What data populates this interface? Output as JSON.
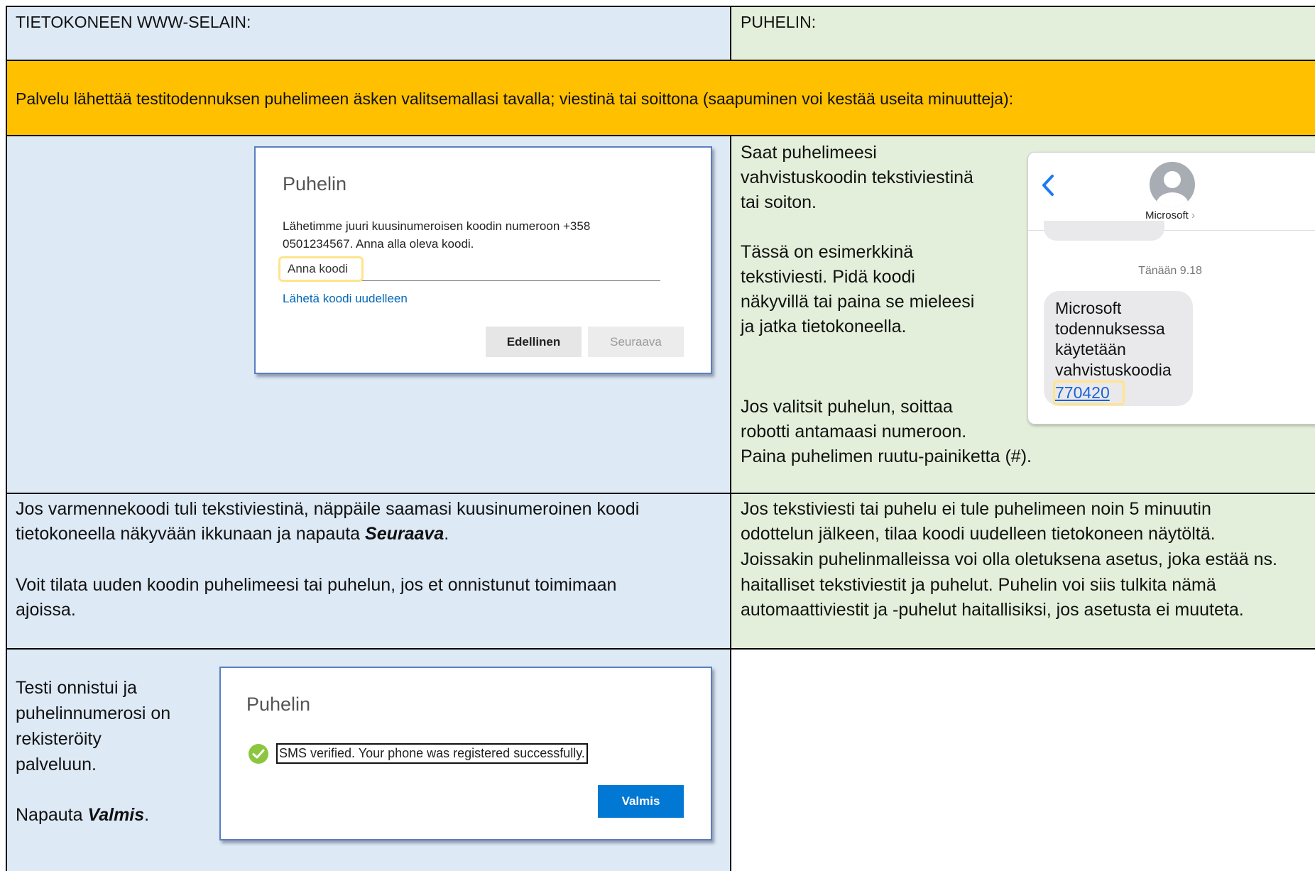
{
  "header": {
    "left": "TIETOKONEEN WWW-SELAIN:",
    "right": "PUHELIN:"
  },
  "banner": "Palvelu lähettää testitodennuksen puhelimeen äsken valitsemallasi tavalla; viestinä tai soittona (saapuminen voi kestää useita minuutteja):",
  "code_dialog": {
    "title": "Puhelin",
    "message_line1": "Lähetimme juuri kuusinumeroisen koodin numeroon +358",
    "message_line2": "0501234567. Anna alla oleva koodi.",
    "input_placeholder": "Anna koodi",
    "resend_link": "Lähetä koodi uudelleen",
    "back_button": "Edellinen",
    "next_button": "Seuraava"
  },
  "phone_instructions": {
    "lines_a": [
      "Saat puhelimeesi",
      "vahvistuskoodin tekstiviestinä",
      "tai soiton."
    ],
    "lines_b": [
      "Tässä on esimerkkinä",
      "tekstiviesti. Pidä koodi",
      "näkyvillä tai paina se mieleesi",
      "ja jatka tietokoneella."
    ],
    "lines_c": [
      "Jos valitsit puhelun, soittaa",
      "robotti antamaasi numeroon.",
      "Paina puhelimen ruutu-painiketta (#)."
    ]
  },
  "sms": {
    "sender": "Microsoft",
    "timestamp": "Tänään 9.18",
    "message_lines": [
      "Microsoft",
      "todennuksessa",
      "käytetään",
      "vahvistuskoodia"
    ],
    "code": "770420",
    "back_icon": "chevron-left-icon",
    "avatar_icon": "person-avatar-icon"
  },
  "left_instructions": {
    "p1_line1": "Jos varmennekoodi tuli tekstiviestinä, näppäile saamasi kuusinumeroinen koodi",
    "p1_line2_pre": "tietokoneella näkyvään ikkunaan ja napauta ",
    "p1_line2_bold": "Seuraava",
    "p1_line2_post": ".",
    "p2_line1": "Voit tilata uuden koodin puhelimeesi tai puhelun, jos et onnistunut toimimaan",
    "p2_line2": "ajoissa."
  },
  "right_instructions": {
    "lines": [
      "Jos tekstiviesti tai puhelu ei tule puhelimeen noin 5 minuutin",
      "odottelun jälkeen, tilaa koodi uudelleen tietokoneen näytöltä.",
      "Joissakin puhelinmalleissa voi olla oletuksena asetus, joka estää ns.",
      "haitalliset tekstiviestit ja puhelut. Puhelin voi siis tulkita nämä",
      "automaattiviestit ja -puhelut haitallisiksi, jos asetusta ei muuteta."
    ]
  },
  "success": {
    "lines": [
      "Testi onnistui ja",
      "puhelinnumerosi on",
      "rekisteröity",
      "palveluun."
    ],
    "tap_pre": "Napauta ",
    "tap_bold": "Valmis",
    "tap_post": ".",
    "dialog_title": "Puhelin",
    "verified_text": "SMS verified. Your phone was registered successfully.",
    "done_button": "Valmis",
    "check_icon": "check-circle-icon"
  },
  "colors": {
    "left_column_bg": "#dde9f5",
    "right_column_bg": "#e3efda",
    "banner_bg": "#ffc000",
    "primary_button": "#0078d4",
    "highlight": "#ffe48a",
    "check_green": "#8cc63f"
  }
}
